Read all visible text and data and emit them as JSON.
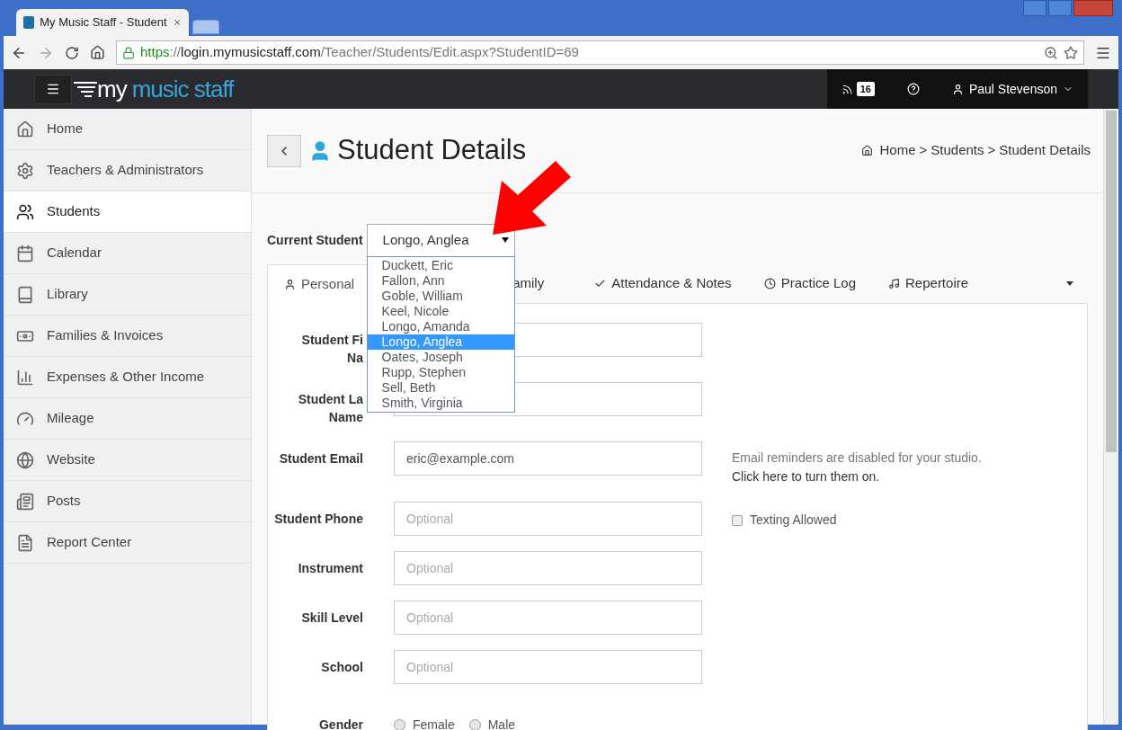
{
  "browser": {
    "tab_title": "My Music Staff - Student",
    "url_parts": [
      {
        "text": "https",
        "kind": "secure"
      },
      {
        "text": "://",
        "kind": "plain"
      },
      {
        "text": "login.mymusicstaff.com",
        "kind": "host"
      },
      {
        "text": "/Teacher/Students/Edit.aspx?StudentID=69",
        "kind": "plain"
      }
    ]
  },
  "header": {
    "logo_first": "my",
    "logo_second": "music staff",
    "feed_count": "16",
    "user_name": "Paul Stevenson"
  },
  "sidebar": {
    "items": [
      {
        "label": "Home",
        "selected": false
      },
      {
        "label": "Teachers & Administrators",
        "selected": false
      },
      {
        "label": "Students",
        "selected": true
      },
      {
        "label": "Calendar",
        "selected": false
      },
      {
        "label": "Library",
        "selected": false
      },
      {
        "label": "Families & Invoices",
        "selected": false
      },
      {
        "label": "Expenses & Other Income",
        "selected": false
      },
      {
        "label": "Mileage",
        "selected": false
      },
      {
        "label": "Website",
        "selected": false
      },
      {
        "label": "Posts",
        "selected": false
      },
      {
        "label": "Report Center",
        "selected": false
      }
    ]
  },
  "page": {
    "title": "Student Details",
    "breadcrumb_separator": ">",
    "breadcrumbs": [
      "Home",
      "Students",
      "Student Details"
    ]
  },
  "current_student": {
    "label": "Current Student",
    "value": "Longo, Anglea",
    "open": true,
    "options": [
      {
        "label": "Duckett, Eric",
        "selected": false
      },
      {
        "label": "Fallon, Ann",
        "selected": false
      },
      {
        "label": "Goble, William",
        "selected": false
      },
      {
        "label": "Keel, Nicole",
        "selected": false
      },
      {
        "label": "Longo, Amanda",
        "selected": false
      },
      {
        "label": "Longo, Anglea",
        "selected": true
      },
      {
        "label": "Oates, Joseph",
        "selected": false
      },
      {
        "label": "Rupp, Stephen",
        "selected": false
      },
      {
        "label": "Sell, Beth",
        "selected": false
      },
      {
        "label": "Smith, Virginia",
        "selected": false
      }
    ]
  },
  "tabs": [
    {
      "label": "Personal",
      "selected": true
    },
    {
      "label": "amily",
      "selected": false
    },
    {
      "label": "Attendance & Notes",
      "selected": false
    },
    {
      "label": "Practice Log",
      "selected": false
    },
    {
      "label": "Repertoire",
      "selected": false
    }
  ],
  "fields": [
    {
      "kind": "text",
      "label_lines": [
        "Student Fi",
        "Na"
      ]
    },
    {
      "kind": "text",
      "label_lines": [
        "Student La",
        "Name"
      ]
    },
    {
      "kind": "text",
      "label_lines": [
        "Student Email"
      ],
      "value": "eric@example.com",
      "note": "Email reminders are disabled for your studio.",
      "link": "Click here to turn them on."
    },
    {
      "kind": "text",
      "label_lines": [
        "Student Phone"
      ],
      "placeholder": "Optional",
      "checkbox": {
        "label": "Texting Allowed",
        "checked": false
      }
    },
    {
      "kind": "text",
      "label_lines": [
        "Instrument"
      ],
      "placeholder": "Optional"
    },
    {
      "kind": "text",
      "label_lines": [
        "Skill Level"
      ],
      "placeholder": "Optional"
    },
    {
      "kind": "text",
      "label_lines": [
        "School"
      ],
      "placeholder": "Optional"
    },
    {
      "kind": "radio",
      "label_lines": [
        "Gender"
      ],
      "options": [
        {
          "label": "Female",
          "selected": false
        },
        {
          "label": "Male",
          "selected": false
        }
      ]
    }
  ]
}
